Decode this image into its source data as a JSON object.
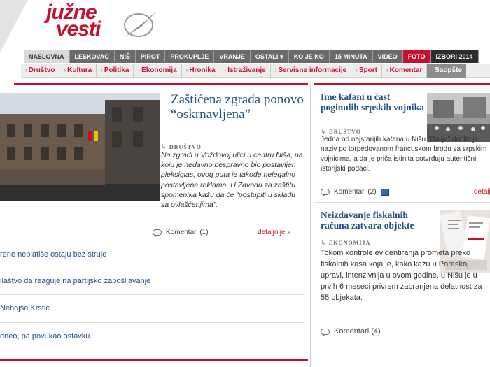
{
  "brand": {
    "line1": "južne",
    "line2": "vesti"
  },
  "nav_primary": [
    {
      "label": "NASLOVNA",
      "style": "active"
    },
    {
      "label": "LESKOVAC",
      "style": ""
    },
    {
      "label": "NIŠ",
      "style": ""
    },
    {
      "label": "PIROT",
      "style": ""
    },
    {
      "label": "PROKUPLJE",
      "style": ""
    },
    {
      "label": "VRANJE",
      "style": ""
    },
    {
      "label": "OSTALI",
      "style": "",
      "has_dropdown": true
    },
    {
      "label": "KO JE KO",
      "style": ""
    },
    {
      "label": "15 MINUTA",
      "style": ""
    },
    {
      "label": "VIDEO",
      "style": ""
    },
    {
      "label": "FOTO",
      "style": "red"
    },
    {
      "label": "IZBORI 2014",
      "style": "dark"
    }
  ],
  "nav_secondary": [
    "Društvo",
    "Kultura",
    "Politika",
    "Ekonomija",
    "Hronika",
    "Istraživanje",
    "Servisne informacije",
    "Sport",
    "Komentar",
    "Saopšte"
  ],
  "feature": {
    "title": "Zaštićena zgrada ponovo “oskrnavljena”",
    "category": "DRUŠTVO",
    "text": "Na zgradi u Voždovoj ulici u centru Niša, na koju je nedavno bespravno bio postavljen pleksiglas, ovog puta je takođe nelegalno postavljena reklama. U Zavodu za zaštitu spomenika kažu da će “postupiti u skladu sa ovlašćenjima”.",
    "comments": "Komentari (1)",
    "more": "detaljnije »"
  },
  "list": [
    "rene neplatiše ostaju bez struje",
    "ilaštvo da reaguje na partijsko zapošljavanje",
    "Nebojša Krstić",
    "dneo, pa povukao ostavku"
  ],
  "side1": {
    "title": "Ime kafani u čast poginulih srpskih vojnika",
    "category": "DRUŠTVO",
    "text": "Jedna od najstarijih kafana u Nišu “Galija” dobila je naziv po torpedovanom francuskom brodu sa srpskim vojnicima, a da je priča istinita potvrđuju autentični istorijski podaci.",
    "comments": "Komentari (2)",
    "more": "detalj"
  },
  "side2": {
    "title": "Neizdavanje fiskalnih računa zatvara objekte",
    "category": "EKONOMIJA",
    "text": "Tokom kontrole evidentiranja prometa preko fiskalnih kasa koja je, kako kažu u Poreskoj upravi, intenzivnija u ovom godine, u Nišu je u prvih 6 meseci privrem zabranjena delatnost za 55 objekata.",
    "comments": "Komentari (4)"
  },
  "colors": {
    "brand_red": "#c8102e",
    "link_blue": "#23508a",
    "nav_gray": "#6a6a6a"
  }
}
